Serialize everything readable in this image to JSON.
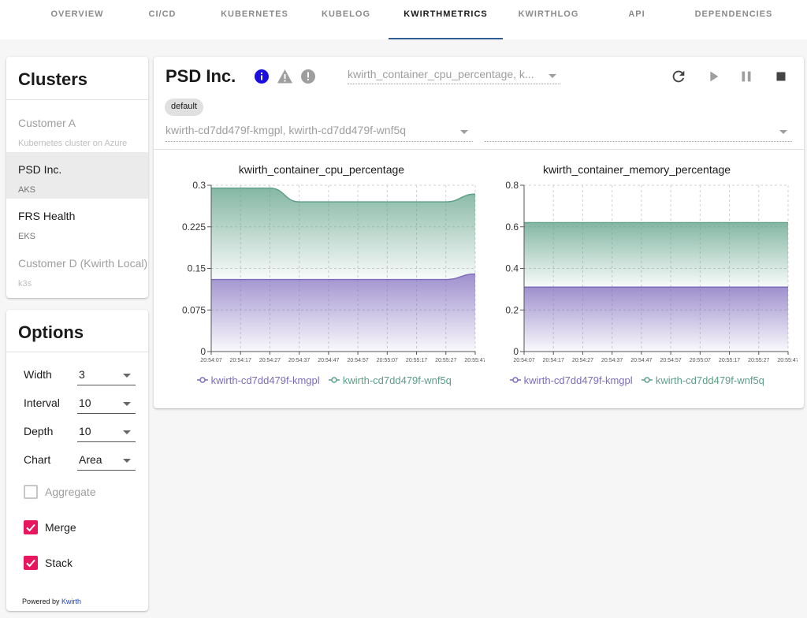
{
  "tabs": [
    {
      "label": "OVERVIEW",
      "name": "tab-overview"
    },
    {
      "label": "CI/CD",
      "name": "tab-cicd"
    },
    {
      "label": "KUBERNETES",
      "name": "tab-kubernetes"
    },
    {
      "label": "KUBELOG",
      "name": "tab-kubelog"
    },
    {
      "label": "KWIRTHMETRICS",
      "name": "tab-kwirthmetrics"
    },
    {
      "label": "KWIRTHLOG",
      "name": "tab-kwirthlog"
    },
    {
      "label": "API",
      "name": "tab-api"
    },
    {
      "label": "DEPENDENCIES",
      "name": "tab-dependencies"
    }
  ],
  "clusters": {
    "title": "Clusters",
    "items": [
      {
        "name": "Customer A",
        "sub": "Kubernetes cluster on Azure"
      },
      {
        "name": "PSD Inc.",
        "sub": "AKS"
      },
      {
        "name": "FRS Health",
        "sub": "EKS"
      },
      {
        "name": "Customer D (Kwirth Local)",
        "sub": "k3s"
      }
    ]
  },
  "options": {
    "title": "Options",
    "width": {
      "label": "Width",
      "value": "3"
    },
    "interval": {
      "label": "Interval",
      "value": "10"
    },
    "depth": {
      "label": "Depth",
      "value": "10"
    },
    "chart": {
      "label": "Chart",
      "value": "Area"
    },
    "aggregate": {
      "label": "Aggregate",
      "checked": false
    },
    "merge": {
      "label": "Merge",
      "checked": true
    },
    "stack": {
      "label": "Stack",
      "checked": true
    },
    "footer_prefix": "Powered by",
    "footer_link": "Kwirth"
  },
  "main": {
    "title": "PSD Inc.",
    "metrics_select": "kwirth_container_cpu_percentage, k...",
    "namespace_chip": "default",
    "pods_select": "kwirth_container_cpu_percentage, k...",
    "pods_value": "kwirth-cd7dd479f-kmgpl, kwirth-cd7dd479f-wnf5q",
    "containers_value": ""
  },
  "colors": {
    "series1": "#7e6bbd",
    "series2": "#5c9f86",
    "info": "#1a0fe0",
    "accent": "#e8175d",
    "active_tab": "#2f5f95"
  },
  "chart_data": [
    {
      "type": "area",
      "title": "kwirth_container_cpu_percentage",
      "x": [
        "20:54:07",
        "20:54:17",
        "20:54:27",
        "20:54:37",
        "20:54:47",
        "20:54:57",
        "20:55:07",
        "20:55:17",
        "20:55:27",
        "20:55:47"
      ],
      "ylim": [
        0,
        0.3
      ],
      "yticks": [
        "0",
        "0.075",
        "0.15",
        "0.225",
        "0.3"
      ],
      "stacked": true,
      "grid": true,
      "legend": "bottom",
      "series": [
        {
          "name": "kwirth-cd7dd479f-kmgpl",
          "values": [
            0.13,
            0.13,
            0.13,
            0.13,
            0.13,
            0.13,
            0.13,
            0.13,
            0.13,
            0.14
          ]
        },
        {
          "name": "kwirth-cd7dd479f-wnf5q",
          "values": [
            0.165,
            0.165,
            0.165,
            0.14,
            0.14,
            0.14,
            0.14,
            0.14,
            0.14,
            0.144
          ]
        }
      ]
    },
    {
      "type": "area",
      "title": "kwirth_container_memory_percentage",
      "x": [
        "20:54:07",
        "20:54:17",
        "20:54:27",
        "20:54:37",
        "20:54:47",
        "20:54:57",
        "20:55:07",
        "20:55:17",
        "20:55:27",
        "20:55:47"
      ],
      "ylim": [
        0,
        0.8
      ],
      "yticks": [
        "0",
        "0.2",
        "0.4",
        "0.6",
        "0.8"
      ],
      "stacked": true,
      "grid": true,
      "legend": "bottom",
      "series": [
        {
          "name": "kwirth-cd7dd479f-kmgpl",
          "values": [
            0.31,
            0.31,
            0.31,
            0.31,
            0.31,
            0.31,
            0.31,
            0.31,
            0.31,
            0.31
          ]
        },
        {
          "name": "kwirth-cd7dd479f-wnf5q",
          "values": [
            0.31,
            0.31,
            0.31,
            0.31,
            0.31,
            0.31,
            0.31,
            0.31,
            0.31,
            0.31
          ]
        }
      ]
    }
  ]
}
